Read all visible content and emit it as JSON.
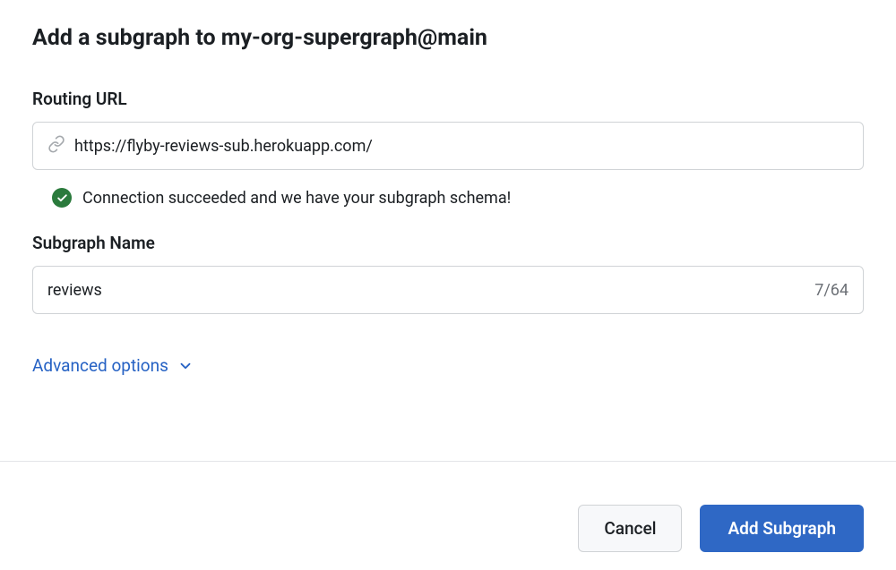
{
  "dialog": {
    "title": "Add a subgraph to my-org-supergraph@main"
  },
  "routing": {
    "label": "Routing URL",
    "value": "https://flyby-reviews-sub.herokuapp.com/",
    "status_text": "Connection succeeded and we have your subgraph schema!"
  },
  "subgraph": {
    "label": "Subgraph Name",
    "value": "reviews",
    "counter": "7/64"
  },
  "advanced": {
    "label": "Advanced options"
  },
  "footer": {
    "cancel_label": "Cancel",
    "submit_label": "Add Subgraph"
  },
  "colors": {
    "success": "#2a7a3c",
    "link": "#2662c4",
    "primary": "#2f68c5"
  }
}
